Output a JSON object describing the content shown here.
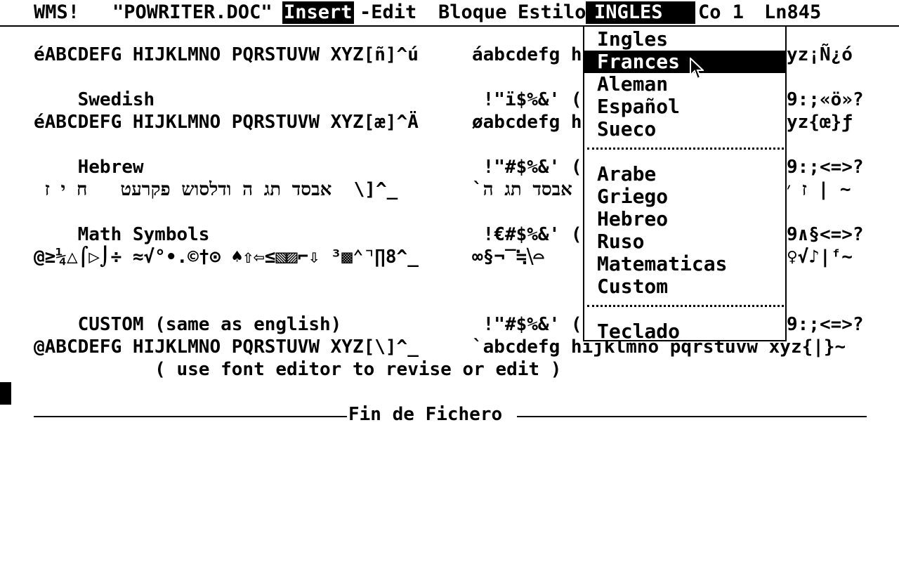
{
  "menubar": {
    "app": "WMS!",
    "filename": "\"POWRITER.DOC\"",
    "insert": "Insert",
    "edit": "-Edit",
    "bloque": "Bloque",
    "estilo": "Estilo",
    "language": "INGLES",
    "column": "Co 1",
    "line": "Ln845"
  },
  "document": {
    "lines": [
      {
        "left": "éABCDEFG HIJKLMNO PQRSTUVW XYZ[ñ]^ú",
        "right": "áabcdefg h",
        "tail": "yz¡Ñ¿ó"
      },
      {
        "left": "    Swedish",
        "right": " !\"ï$%&' (",
        "tail": "9:;«ö»?"
      },
      {
        "left": "éABCDEFG HIJKLMNO PQRSTUVW XYZ[æ]^Ä",
        "right": "øabcdefg h",
        "tail": "yz{œ}ƒ"
      },
      {
        "left": "    Hebrew",
        "right": " !\"#$%&' (",
        "tail": "9:;<=>?"
      },
      {
        "left": " אבסד תג ה ודלסוש פקרעט   ח י ז  \\]^_",
        "right": "`אבסד תג ה",
        "tail": "ז ׳ | ~"
      },
      {
        "left": "    Math Symbols",
        "right": " !€#$%&' (",
        "tail": "9∧§<=>?"
      },
      {
        "left": "@≥¼△⌠▷⌡÷ ≈√°•.©†⊙ ♠⇧⇦≤▧▨⌐⇩ ³▩⌃⌝∏8^_",
        "right": "∞§¬‾≒⧹⌓",
        "tail": "♀√♪|ᶠ~"
      },
      {
        "left": "    CUSTOM (same as english)",
        "right": " !\"#$%&' (",
        "tail": "9:;<=>?"
      },
      {
        "left": "@ABCDEFG HIJKLMNO PQRSTUVW XYZ[\\]^_",
        "right": "`abcdefg hijklmno pqrstuvw xyz{|}~",
        "tail": ""
      },
      {
        "left": "           ( use font editor to revise or edit )",
        "right": "",
        "tail": ""
      }
    ],
    "end_label": "Fin de Fichero"
  },
  "language_menu": {
    "items": [
      "Ingles",
      "Frances",
      "Aleman",
      "Español",
      "Sueco"
    ],
    "items2": [
      "Arabe",
      "Griego",
      "Hebreo",
      "Ruso",
      "Matematicas",
      "Custom"
    ],
    "items3": [
      "Teclado"
    ],
    "selected": "Frances"
  },
  "icons": {
    "pointer": "arrow-pointer-icon"
  },
  "colors": {
    "foreground": "#000000",
    "background": "#ffffff"
  }
}
